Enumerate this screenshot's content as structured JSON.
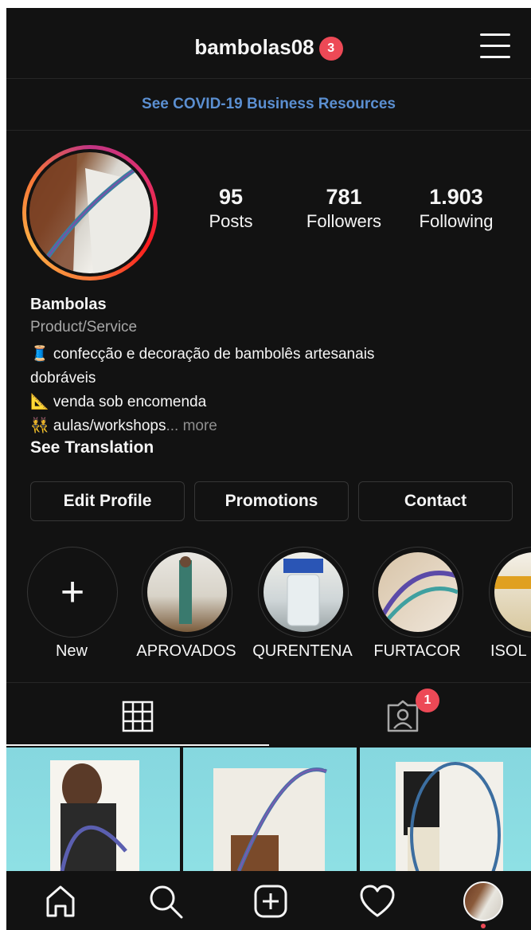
{
  "header": {
    "username": "bambolas08",
    "notification_count": "3"
  },
  "banner": {
    "covid_link": "See COVID-19 Business Resources"
  },
  "profile": {
    "stats": [
      {
        "value": "95",
        "label": "Posts"
      },
      {
        "value": "781",
        "label": "Followers"
      },
      {
        "value": "1.903",
        "label": "Following"
      }
    ],
    "name": "Bambolas",
    "category": "Product/Service",
    "bio_line1": "🧵 confecção e decoração de bambolês artesanais",
    "bio_line2": "dobráveis",
    "bio_line3": "📐 venda sob encomenda",
    "bio_line4": "👯 aulas/workshops",
    "bio_more": "... more",
    "see_translation": "See Translation"
  },
  "actions": {
    "edit_profile": "Edit Profile",
    "promotions": "Promotions",
    "contact": "Contact"
  },
  "highlights": [
    {
      "label": "New"
    },
    {
      "label": "APROVADOS"
    },
    {
      "label": "QURENTENA"
    },
    {
      "label": "FURTACOR"
    },
    {
      "label": "ISOL"
    }
  ],
  "tabs": {
    "tagged_count": "1"
  },
  "icons": {
    "menu": "hamburger-menu-icon",
    "grid": "grid-icon",
    "tagged": "tagged-person-icon",
    "home": "home-icon",
    "search": "search-icon",
    "new_post": "plus-square-icon",
    "activity": "heart-icon",
    "profile": "profile-avatar-icon"
  },
  "colors": {
    "background": "#121212",
    "link": "#5b8fd1",
    "badge": "#ed4956",
    "secondary_text": "#a8a8a8"
  }
}
